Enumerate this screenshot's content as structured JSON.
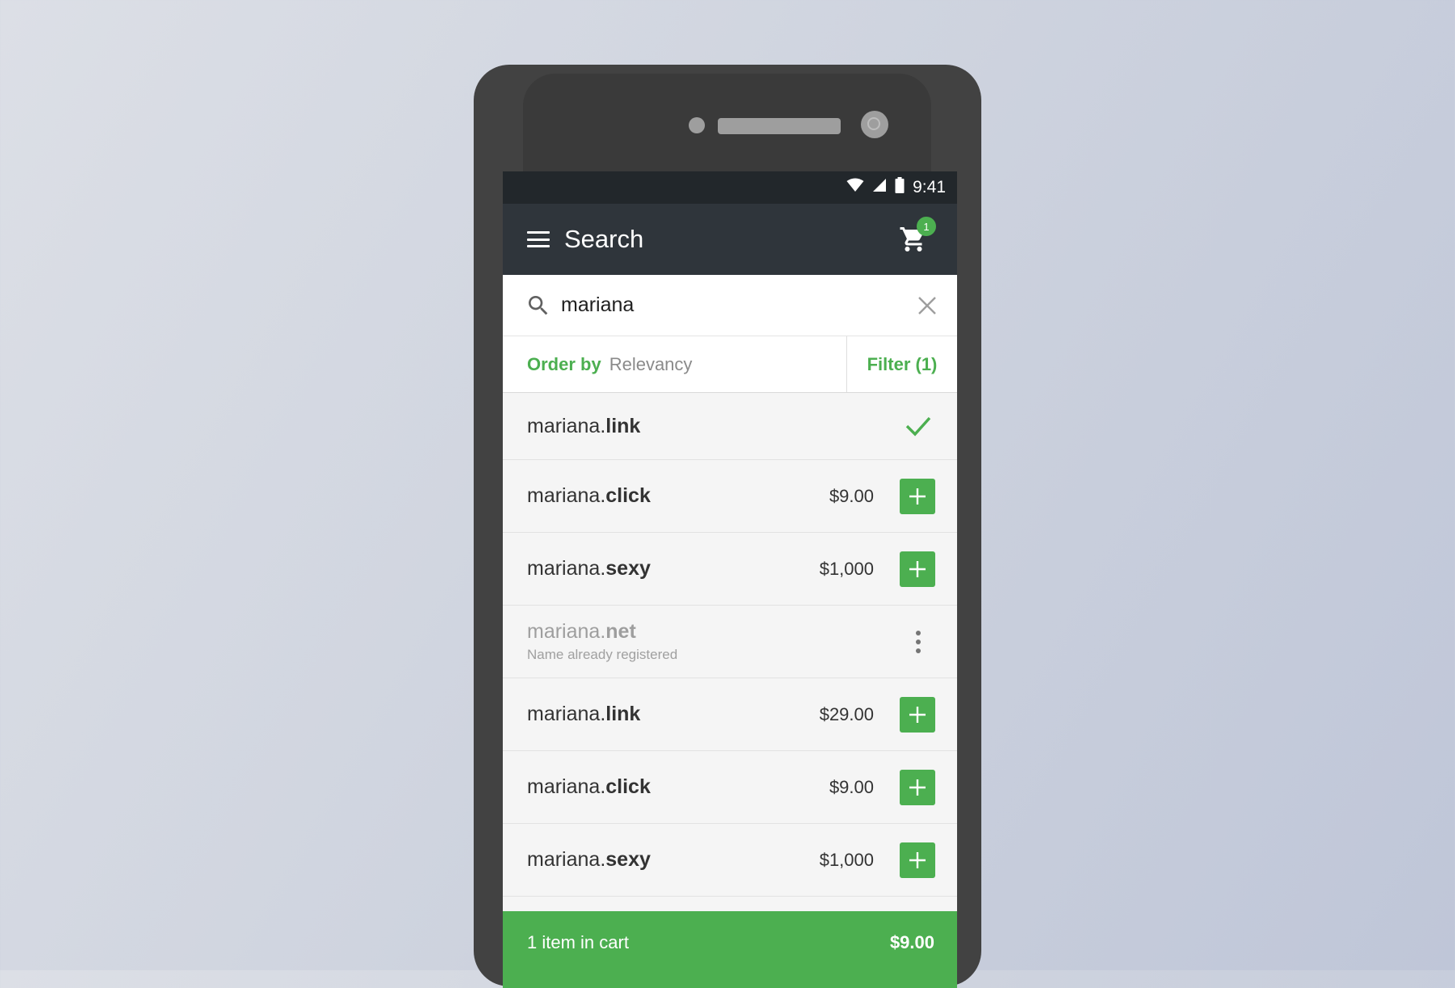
{
  "status_bar": {
    "time": "9:41"
  },
  "app_bar": {
    "title": "Search",
    "cart_count": "1"
  },
  "search": {
    "value": "mariana"
  },
  "sort": {
    "order_label": "Order by",
    "order_value": "Relevancy",
    "filter_label": "Filter (1)"
  },
  "results": [
    {
      "name": "mariana.",
      "tld": "link",
      "state": "added"
    },
    {
      "name": "mariana.",
      "tld": "click",
      "price": "$9.00",
      "state": "available"
    },
    {
      "name": "mariana.",
      "tld": "sexy",
      "price": "$1,000",
      "state": "available"
    },
    {
      "name": "mariana.",
      "tld": "net",
      "note": "Name already registered",
      "state": "taken"
    },
    {
      "name": "mariana.",
      "tld": "link",
      "price": "$29.00",
      "state": "available"
    },
    {
      "name": "mariana.",
      "tld": "click",
      "price": "$9.00",
      "state": "available"
    },
    {
      "name": "mariana.",
      "tld": "sexy",
      "price": "$1,000",
      "state": "available"
    }
  ],
  "cart_bar": {
    "text": "1 item in cart",
    "total": "$9.00"
  },
  "colors": {
    "accent": "#4caf50",
    "app_bar": "#2f353b",
    "status_bar": "#22272b"
  }
}
